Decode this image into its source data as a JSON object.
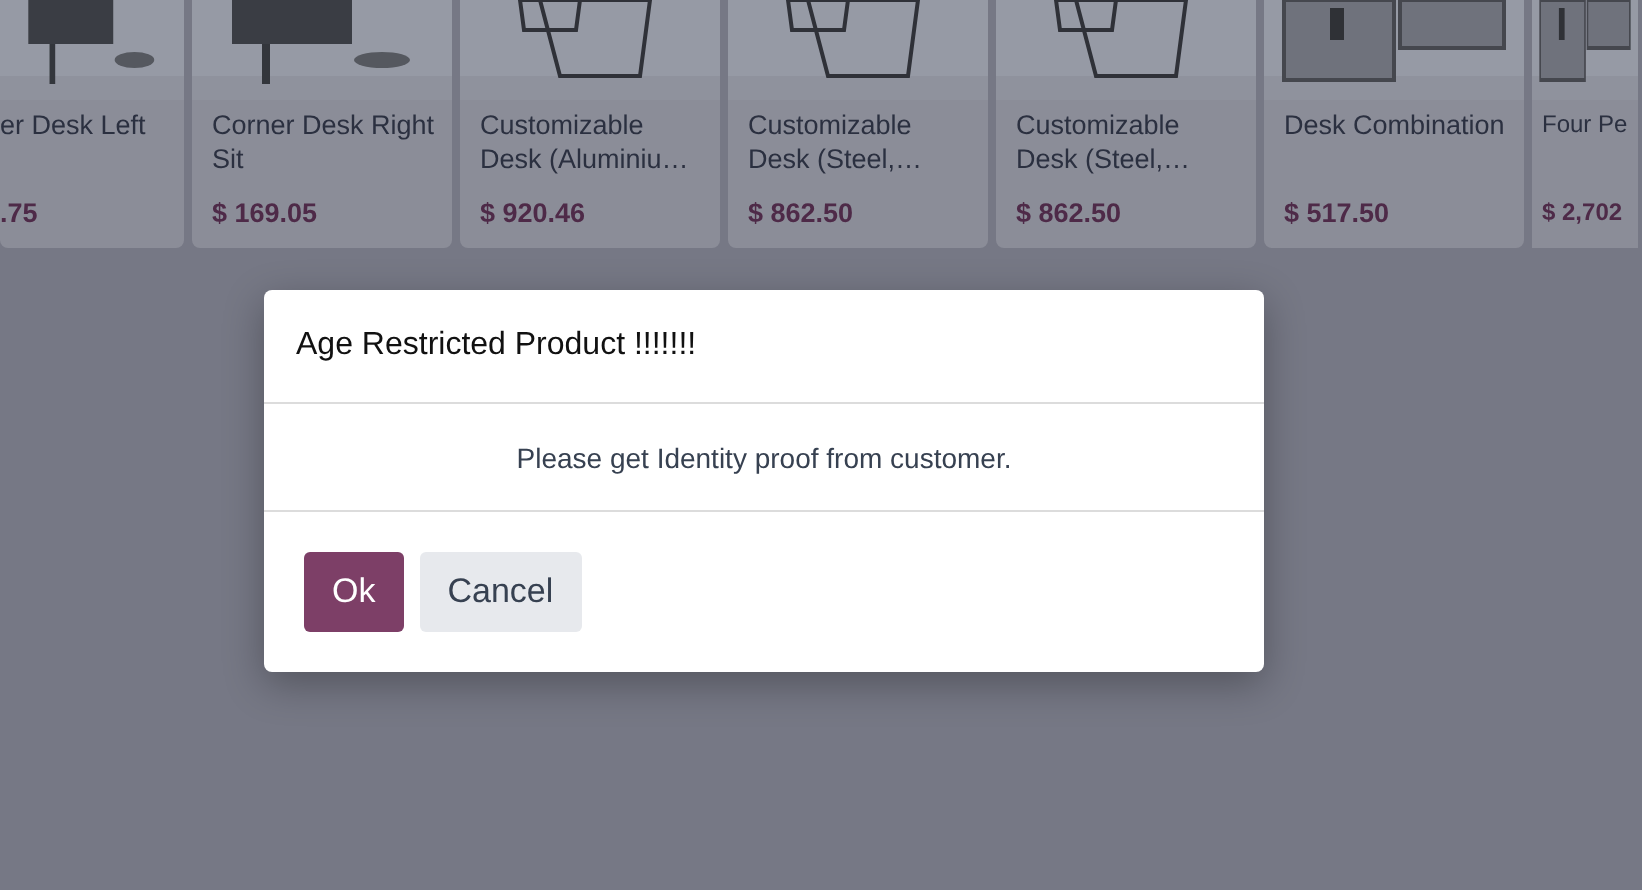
{
  "products": [
    {
      "name": "er Desk Left",
      "price": ".75"
    },
    {
      "name": "Corner Desk Right Sit",
      "price": "$ 169.05"
    },
    {
      "name": "Customizable Desk (Aluminiu…",
      "price": "$ 920.46"
    },
    {
      "name": "Customizable Desk (Steel,…",
      "price": "$ 862.50"
    },
    {
      "name": "Customizable Desk (Steel,…",
      "price": "$ 862.50"
    },
    {
      "name": "Desk Combination",
      "price": "$ 517.50"
    },
    {
      "name": "Four Pe",
      "price": "$ 2,702"
    }
  ],
  "dialog": {
    "title": "Age Restricted Product !!!!!!!",
    "message": "Please get Identity proof from customer.",
    "buttons": [
      {
        "label": "Ok",
        "kind": "primary"
      },
      {
        "label": "Cancel",
        "kind": "secondary"
      }
    ]
  }
}
